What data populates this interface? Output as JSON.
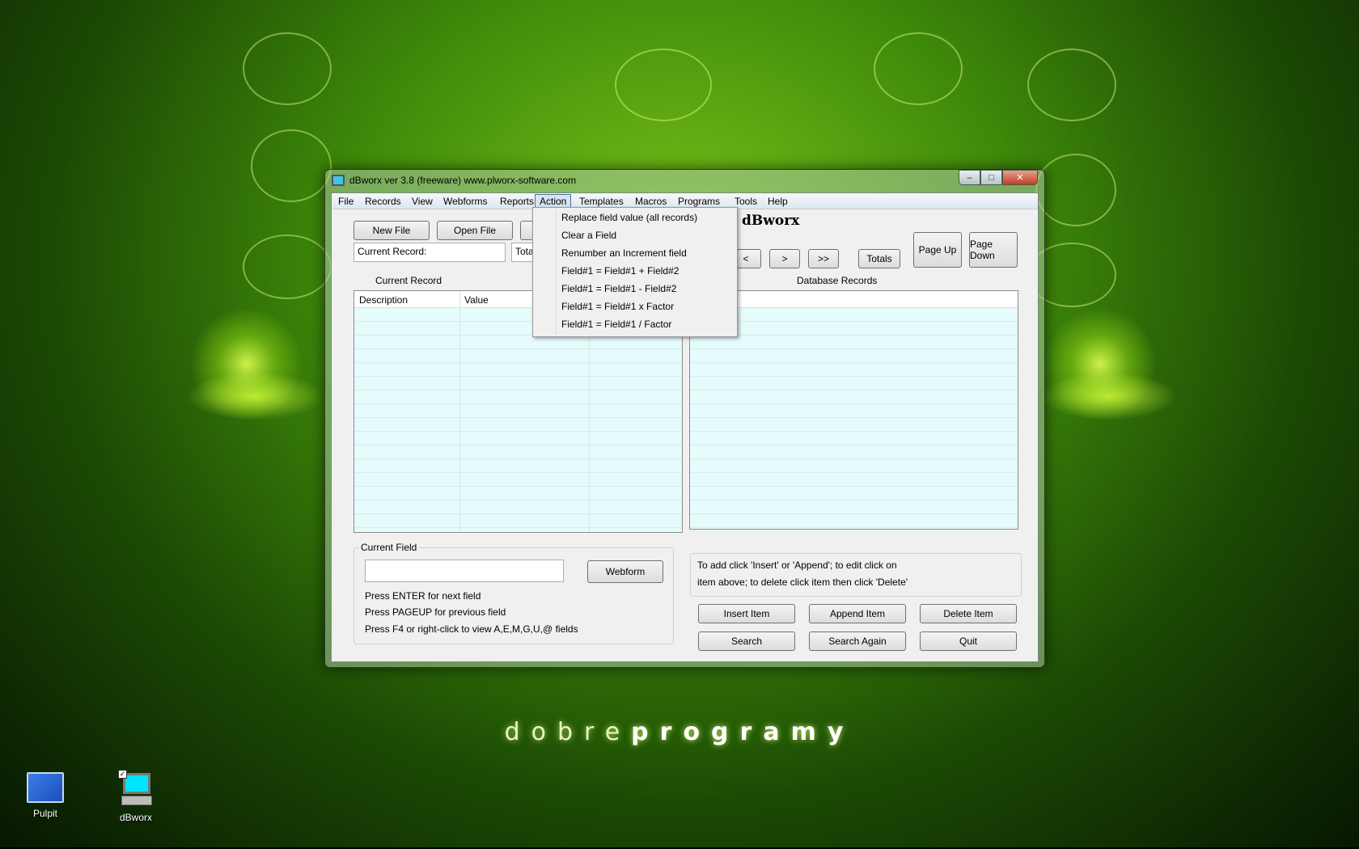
{
  "window": {
    "title": "dBworx ver 3.8 (freeware)    www.plworx-software.com",
    "min_glyph": "–",
    "max_glyph": "□",
    "close_glyph": "✕"
  },
  "menubar": {
    "items": [
      "File",
      "Records",
      "View",
      "Webforms",
      "Reports",
      "Action",
      "Templates",
      "Macros",
      "Programs",
      "Tools",
      "Help"
    ]
  },
  "toolbar": {
    "new_file": "New File",
    "open_file": "Open File",
    "app_title": "dBworx",
    "prev": "<",
    "next": ">",
    "last": ">>",
    "totals": "Totals",
    "page_up": "Page Up",
    "page_down": "Page Down"
  },
  "status": {
    "current_record_label": "Current Record:",
    "total_label": "Total"
  },
  "current_record": {
    "title": "Current Record",
    "columns": [
      "Description",
      "Value"
    ]
  },
  "database_records": {
    "title": "Database Records"
  },
  "current_field": {
    "title": "Current Field",
    "value": "",
    "webform": "Webform",
    "hint1": "Press ENTER for next field",
    "hint2": "Press PAGEUP for previous field",
    "hint3": "Press F4 or right-click to view A,E,M,G,U,@ fields"
  },
  "instructions": {
    "line1": "To add click 'Insert' or 'Append'; to edit click on",
    "line2": "item above; to delete click item then click 'Delete'"
  },
  "actions": {
    "insert": "Insert Item",
    "append": "Append Item",
    "delete": "Delete Item",
    "search": "Search",
    "search_again": "Search Again",
    "quit": "Quit"
  },
  "action_menu": {
    "items": [
      "Replace field value (all records)",
      "Clear a Field",
      "Renumber an Increment field",
      "Field#1 = Field#1 + Field#2",
      "Field#1 = Field#1 - Field#2",
      "Field#1 = Field#1 x Factor",
      "Field#1 = Field#1 / Factor"
    ]
  },
  "desktop": {
    "icons": [
      "Pulpit",
      "dBworx"
    ],
    "brand_light": "dobre",
    "brand_bold": "programy"
  }
}
